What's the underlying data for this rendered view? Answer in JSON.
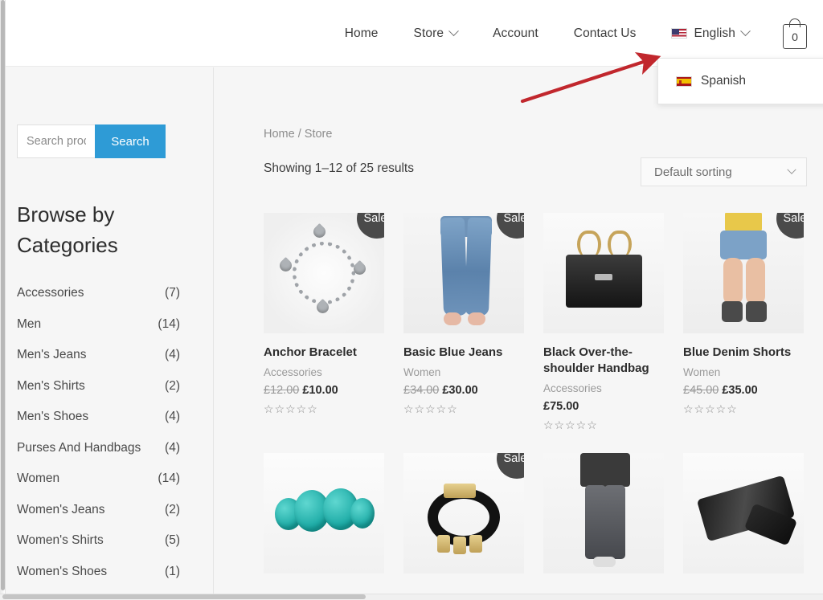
{
  "nav": {
    "items": [
      {
        "label": "Home",
        "has_caret": false,
        "icon": null
      },
      {
        "label": "Store",
        "has_caret": true,
        "icon": null
      },
      {
        "label": "Account",
        "has_caret": false,
        "icon": null
      },
      {
        "label": "Contact Us",
        "has_caret": false,
        "icon": null
      },
      {
        "label": "English",
        "has_caret": true,
        "icon": "us-flag-icon"
      }
    ],
    "cart_count": "0"
  },
  "language_dropdown": {
    "options": [
      {
        "label": "Spanish",
        "icon": "es-flag-icon"
      }
    ]
  },
  "annotation": {
    "arrow_color": "#c1272d"
  },
  "sidebar": {
    "search": {
      "placeholder": "Search products…",
      "value": "",
      "button_label": "Search"
    },
    "browse_title": "Browse by Categories",
    "categories": [
      {
        "label": "Accessories",
        "count": "(7)"
      },
      {
        "label": "Men",
        "count": "(14)"
      },
      {
        "label": "Men's Jeans",
        "count": "(4)"
      },
      {
        "label": "Men's Shirts",
        "count": "(2)"
      },
      {
        "label": "Men's Shoes",
        "count": "(4)"
      },
      {
        "label": "Purses And Handbags",
        "count": "(4)"
      },
      {
        "label": "Women",
        "count": "(14)"
      },
      {
        "label": "Women's Jeans",
        "count": "(2)"
      },
      {
        "label": "Women's Shirts",
        "count": "(5)"
      },
      {
        "label": "Women's Shoes",
        "count": "(1)"
      }
    ]
  },
  "main": {
    "breadcrumb_home": "Home",
    "breadcrumb_sep": " / ",
    "breadcrumb_current": "Store",
    "results_text": "Showing 1–12 of 25 results",
    "sorting_value": "Default sorting",
    "sale_badge_label": "Sale!",
    "stars_empty": "☆☆☆☆☆",
    "products": [
      {
        "title": "Anchor Bracelet",
        "category": "Accessories",
        "old_price": "£12.00",
        "price": "£10.00",
        "on_sale": true,
        "art": "bracelet",
        "show_meta": true
      },
      {
        "title": "Basic Blue Jeans",
        "category": "Women",
        "old_price": "£34.00",
        "price": "£30.00",
        "on_sale": true,
        "art": "jeans",
        "show_meta": true
      },
      {
        "title": "Black Over-the-shoulder Handbag",
        "category": "Accessories",
        "old_price": "",
        "price": "£75.00",
        "on_sale": false,
        "art": "bag",
        "show_meta": true
      },
      {
        "title": "Blue Denim Shorts",
        "category": "Women",
        "old_price": "£45.00",
        "price": "£35.00",
        "on_sale": true,
        "art": "shorts",
        "show_meta": true
      },
      {
        "title": "",
        "category": "",
        "old_price": "",
        "price": "",
        "on_sale": false,
        "art": "turquoise",
        "show_meta": false
      },
      {
        "title": "",
        "category": "",
        "old_price": "",
        "price": "",
        "on_sale": true,
        "art": "black-bracelet",
        "show_meta": false
      },
      {
        "title": "",
        "category": "",
        "old_price": "",
        "price": "",
        "on_sale": false,
        "art": "mens-jeans",
        "show_meta": false
      },
      {
        "title": "",
        "category": "",
        "old_price": "",
        "price": "",
        "on_sale": false,
        "art": "black-pants",
        "show_meta": false
      }
    ]
  },
  "colors": {
    "accent_blue": "#2e9bd6",
    "sale_badge": "#4a4a4a",
    "page_bg": "#f6f6f6",
    "arrow_red": "#c1272d"
  }
}
